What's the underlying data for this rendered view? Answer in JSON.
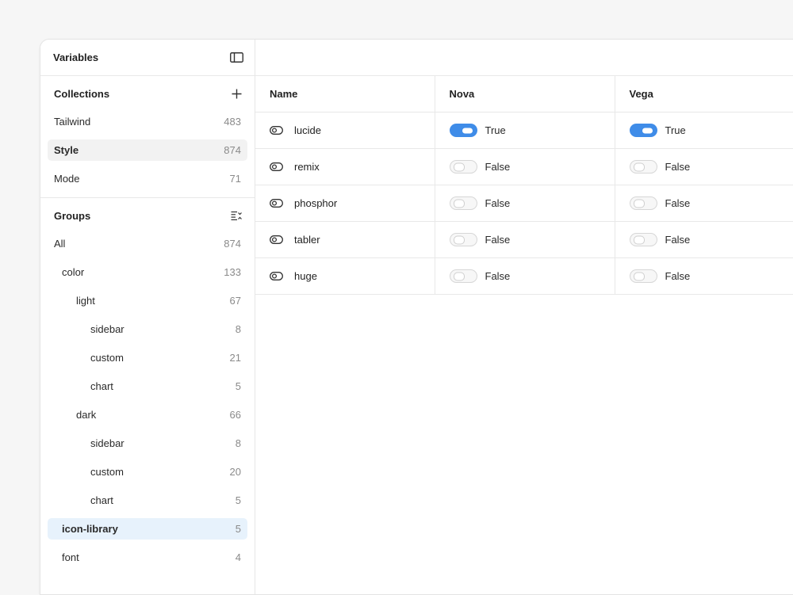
{
  "sidebar": {
    "title": "Variables",
    "panel_icon": "sidebar-panel-icon",
    "collections": {
      "title": "Collections",
      "add_icon": "plus-icon",
      "items": [
        {
          "label": "Tailwind",
          "count": "483"
        },
        {
          "label": "Style",
          "count": "874"
        },
        {
          "label": "Mode",
          "count": "71"
        }
      ]
    },
    "groups": {
      "title": "Groups",
      "sort_icon": "list-sort-icon",
      "items": [
        {
          "label": "All",
          "count": "874"
        },
        {
          "label": "color",
          "count": "133"
        },
        {
          "label": "light",
          "count": "67"
        },
        {
          "label": "sidebar",
          "count": "8"
        },
        {
          "label": "custom",
          "count": "21"
        },
        {
          "label": "chart",
          "count": "5"
        },
        {
          "label": "dark",
          "count": "66"
        },
        {
          "label": "sidebar",
          "count": "8"
        },
        {
          "label": "custom",
          "count": "20"
        },
        {
          "label": "chart",
          "count": "5"
        },
        {
          "label": "icon-library",
          "count": "5"
        },
        {
          "label": "font",
          "count": "4"
        }
      ]
    }
  },
  "table": {
    "columns": [
      "Name",
      "Nova",
      "Vega"
    ],
    "rows": [
      {
        "name": "lucide",
        "nova": "True",
        "vega": "True",
        "nova_on": true,
        "vega_on": true
      },
      {
        "name": "remix",
        "nova": "False",
        "vega": "False",
        "nova_on": false,
        "vega_on": false
      },
      {
        "name": "phosphor",
        "nova": "False",
        "vega": "False",
        "nova_on": false,
        "vega_on": false
      },
      {
        "name": "tabler",
        "nova": "False",
        "vega": "False",
        "nova_on": false,
        "vega_on": false
      },
      {
        "name": "huge",
        "nova": "False",
        "vega": "False",
        "nova_on": false,
        "vega_on": false
      }
    ],
    "row_icon": "boolean-toggle-icon"
  },
  "colors": {
    "accent": "#3f8ce8",
    "selected_blue_bg": "#e7f2fc",
    "selected_gray_bg": "#f2f2f2"
  }
}
